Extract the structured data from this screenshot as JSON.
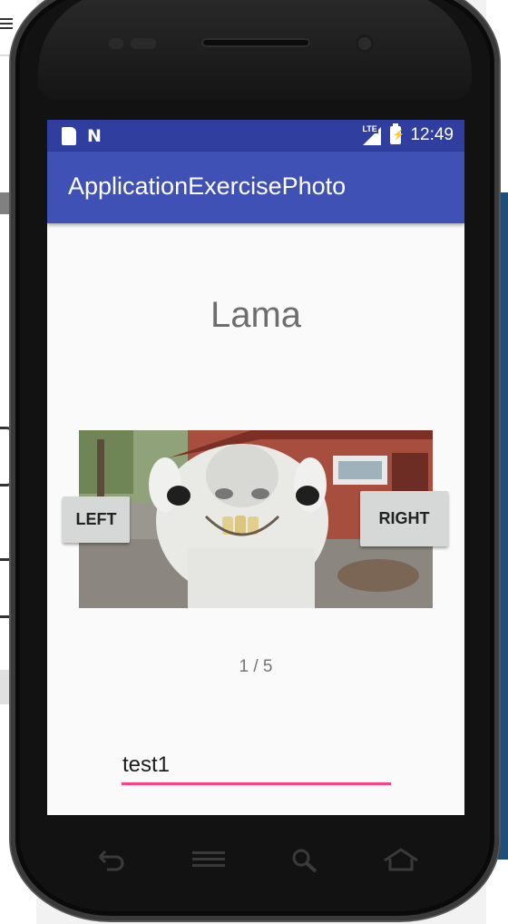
{
  "status_bar": {
    "time": "12:49",
    "network_label": "LTE",
    "icons": [
      "sd-card-icon",
      "n-notification-icon",
      "lte-signal-icon",
      "battery-charging-icon"
    ]
  },
  "app_bar": {
    "title": "ApplicationExercisePhoto"
  },
  "content": {
    "photo_name": "Lama",
    "photo_description": "llama close-up",
    "left_button": "LEFT",
    "right_button": "RIGHT",
    "counter": "1 / 5",
    "edit_value": "test1"
  },
  "hardware_buttons": [
    "back-icon",
    "menu-icon",
    "search-icon",
    "home-icon"
  ],
  "colors": {
    "status_bar": "#303f9f",
    "app_bar": "#3f51b5",
    "accent": "#ff4081",
    "background": "#fafafa"
  }
}
